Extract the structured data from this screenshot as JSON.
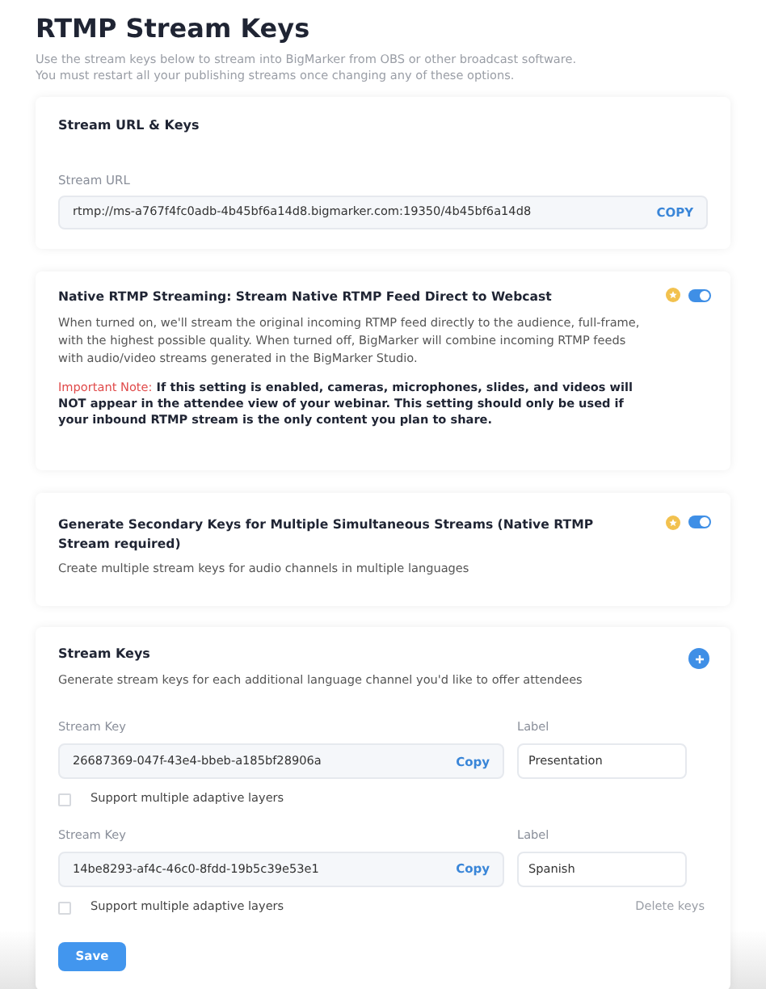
{
  "title": "RTMP Stream Keys",
  "intro": [
    "Use the stream keys below to stream into BigMarker from OBS or other broadcast software.",
    "You must restart all your publishing streams once changing any of these options."
  ],
  "url_card": {
    "heading": "Stream URL & Keys",
    "field_label": "Stream URL",
    "value": "rtmp://ms-a767f4fc0adb-4b45bf6a14d8.bigmarker.com:19350/4b45bf6a14d8",
    "copy": "COPY"
  },
  "settings": [
    {
      "heading": "Native RTMP Streaming: Stream Native RTMP Feed Direct to Webcast",
      "description": "When turned on, we'll stream the original incoming RTMP feed directly to the audience, full-frame, with the highest possible quality. When turned off, BigMarker will combine incoming RTMP feeds with audio/video streams generated in the BigMarker Studio.",
      "note_label": "Important Note:",
      "note": "If this setting is enabled, cameras, microphones, slides, and videos will NOT appear in the attendee view of your webinar. This setting should only be used if your inbound RTMP stream is the only content you plan to share.",
      "on": true
    },
    {
      "heading": "Generate Secondary Keys for Multiple Simultaneous Streams (Native RTMP Stream required)",
      "description": "Create multiple stream keys for audio channels in multiple languages",
      "on": true
    }
  ],
  "keys_card": {
    "heading": "Stream Keys",
    "description": "Generate stream keys for each additional language channel you'd like to offer attendees",
    "keys": [
      {
        "key_label": "Stream Key",
        "key": "26687369-047f-43e4-bbeb-a185bf28906a",
        "copy": "Copy",
        "label_label": "Label",
        "label": "Presentation",
        "checkbox": "Support multiple adaptive layers",
        "checked": false
      },
      {
        "key_label": "Stream Key",
        "key": "14be8293-af4c-46c0-8fdd-19b5c39e53e1",
        "copy": "Copy",
        "label_label": "Label",
        "label": "Spanish",
        "checkbox": "Support multiple adaptive layers",
        "checked": false,
        "delete": "Delete keys"
      }
    ],
    "save": "Save"
  }
}
